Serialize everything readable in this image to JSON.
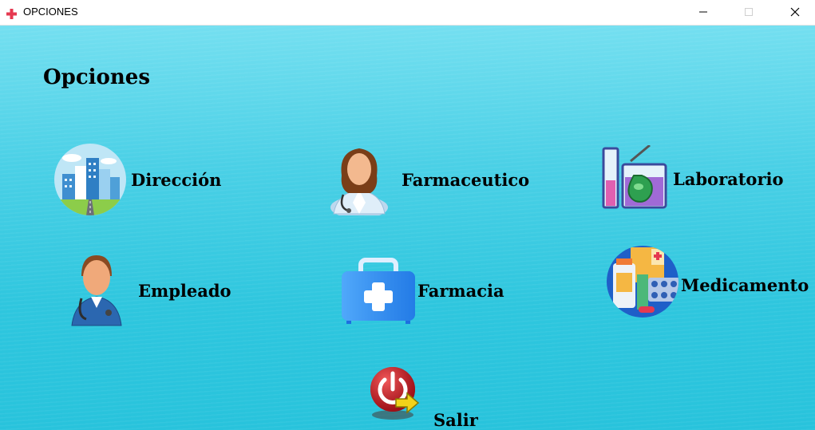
{
  "window": {
    "title": "OPCIONES",
    "app_icon": "red-cross-icon",
    "controls": [
      "minimize-icon",
      "maximize-icon",
      "close-icon"
    ]
  },
  "heading": "Opciones",
  "colors": {
    "background_top": "#74dff0",
    "background_bottom": "#28c3dc",
    "text": "#000000",
    "accent_red": "#e53950"
  },
  "options": {
    "direccion": {
      "label": "Dirección",
      "icon": "city-buildings-icon"
    },
    "farmaceutico": {
      "label": "Farmaceutico",
      "icon": "female-doctor-icon"
    },
    "laboratorio": {
      "label": "Laboratorio",
      "icon": "lab-beaker-icon"
    },
    "empleado": {
      "label": "Empleado",
      "icon": "male-doctor-icon"
    },
    "farmacia": {
      "label": "Farmacia",
      "icon": "first-aid-kit-icon"
    },
    "medicamento": {
      "label": "Medicamento",
      "icon": "medicine-bottles-icon"
    },
    "salir": {
      "label": "Salir",
      "icon": "power-exit-icon"
    }
  }
}
